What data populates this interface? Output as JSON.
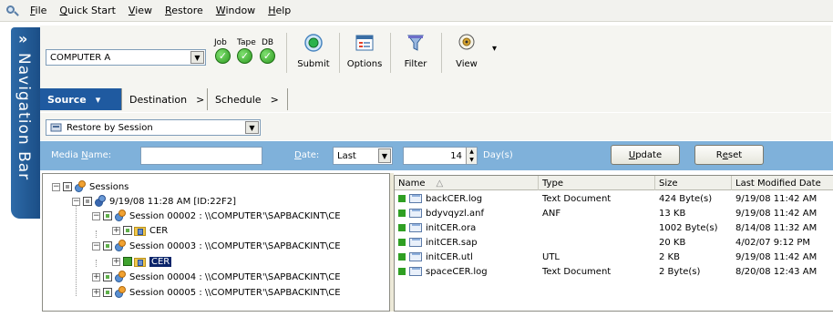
{
  "menu": {
    "items": [
      {
        "key": "F",
        "rest": "ile"
      },
      {
        "key": "Q",
        "rest": "uick Start"
      },
      {
        "key": "V",
        "rest": "iew"
      },
      {
        "key": "R",
        "rest": "estore"
      },
      {
        "key": "W",
        "rest": "indow"
      },
      {
        "key": "H",
        "rest": "elp"
      }
    ]
  },
  "navigation": {
    "label": "Navigation Bar",
    "chevron": "»"
  },
  "toolbar": {
    "computer": "COMPUTER A",
    "job_label": "Job",
    "tape_label": "Tape",
    "db_label": "DB",
    "check": "✓",
    "submit": "Submit",
    "options": "Options",
    "filter": "Filter",
    "view": "View",
    "view_dropdown": "▾"
  },
  "tabs": [
    {
      "label": "Source",
      "arrow": "▾"
    },
    {
      "label": "Destination",
      "arrow": ">"
    },
    {
      "label": "Schedule",
      "arrow": ">"
    }
  ],
  "restore_mode": {
    "value": "Restore by Session",
    "arrow": "▾"
  },
  "filter": {
    "media_key": "N",
    "media_pre": "Media ",
    "media_post": "ame:",
    "media_value": "",
    "date_key": "D",
    "date_post": "ate:",
    "date_value": "Last",
    "days_value": "14",
    "days_label": "Day(s)",
    "update_key": "U",
    "update_post": "pdate",
    "reset_pre": "R",
    "reset_key": "e",
    "reset_post": "set"
  },
  "tree": {
    "root": "Sessions",
    "date_node": "9/19/08 11:28 AM [ID:22F2]",
    "sessions": [
      {
        "label": "Session 00002 : \\\\COMPUTER'\\SAPBACKINT\\CE",
        "child": "CER"
      },
      {
        "label": "Session 00003 :  \\\\COMPUTER'\\SAPBACKINT\\CE",
        "child": "CER"
      },
      {
        "label": "Session 00004 : \\\\COMPUTER'\\SAPBACKINT\\CE"
      },
      {
        "label": "Session 00005 : \\\\COMPUTER'\\SAPBACKINT\\CE"
      }
    ]
  },
  "list": {
    "headers": {
      "name": "Name",
      "sort": "△",
      "type": "Type",
      "size": "Size",
      "modified": "Last Modified Date"
    },
    "rows": [
      {
        "name": "backCER.log",
        "type": "Text Document",
        "size": "424 Byte(s)",
        "modified": "9/19/08 11:42 AM"
      },
      {
        "name": "bdyvqyzl.anf",
        "type": "ANF",
        "size": "13 KB",
        "modified": "9/19/08 11:42 AM"
      },
      {
        "name": "initCER.ora",
        "type": "",
        "size": "1002 Byte(s)",
        "modified": "8/14/08 11:32 AM"
      },
      {
        "name": "initCER.sap",
        "type": "",
        "size": "20 KB",
        "modified": "4/02/07  9:12 PM"
      },
      {
        "name": "initCER.utl",
        "type": "UTL",
        "size": "2 KB",
        "modified": "9/19/08 11:42 AM"
      },
      {
        "name": "spaceCER.log",
        "type": "Text Document",
        "size": "2 Byte(s)",
        "modified": "8/20/08 12:43 AM"
      }
    ]
  }
}
